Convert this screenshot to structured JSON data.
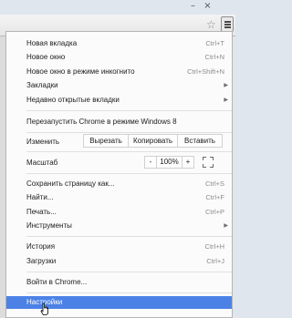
{
  "window": {
    "minimize_icon": "minimize-icon",
    "close_icon": "close-icon"
  },
  "toolbar": {
    "bookmark_icon": "star-icon",
    "menu_icon": "hamburger-menu-icon"
  },
  "menu": {
    "new_tab": {
      "label": "Новая вкладка",
      "shortcut": "Ctrl+T"
    },
    "new_window": {
      "label": "Новое окно",
      "shortcut": "Ctrl+N"
    },
    "incognito": {
      "label": "Новое окно в режиме инкогнито",
      "shortcut": "Ctrl+Shift+N"
    },
    "bookmarks": {
      "label": "Закладки"
    },
    "recent_tabs": {
      "label": "Недавно открытые вкладки"
    },
    "relaunch": {
      "label": "Перезапустить Chrome в режиме Windows 8"
    },
    "edit": {
      "label": "Изменить",
      "cut": "Вырезать",
      "copy": "Копировать",
      "paste": "Вставить"
    },
    "zoom": {
      "label": "Масштаб",
      "minus": "-",
      "value": "100%",
      "plus": "+"
    },
    "save_page": {
      "label": "Сохранить страницу как...",
      "shortcut": "Ctrl+S"
    },
    "find": {
      "label": "Найти...",
      "shortcut": "Ctrl+F"
    },
    "print": {
      "label": "Печать...",
      "shortcut": "Ctrl+P"
    },
    "tools": {
      "label": "Инструменты"
    },
    "history": {
      "label": "История",
      "shortcut": "Ctrl+H"
    },
    "downloads": {
      "label": "Загрузки",
      "shortcut": "Ctrl+J"
    },
    "signin": {
      "label": "Войти в Chrome..."
    },
    "settings": {
      "label": "Настройки"
    }
  },
  "colors": {
    "highlight": "#4c82e6",
    "shortcut_text": "#8c8c8c"
  }
}
